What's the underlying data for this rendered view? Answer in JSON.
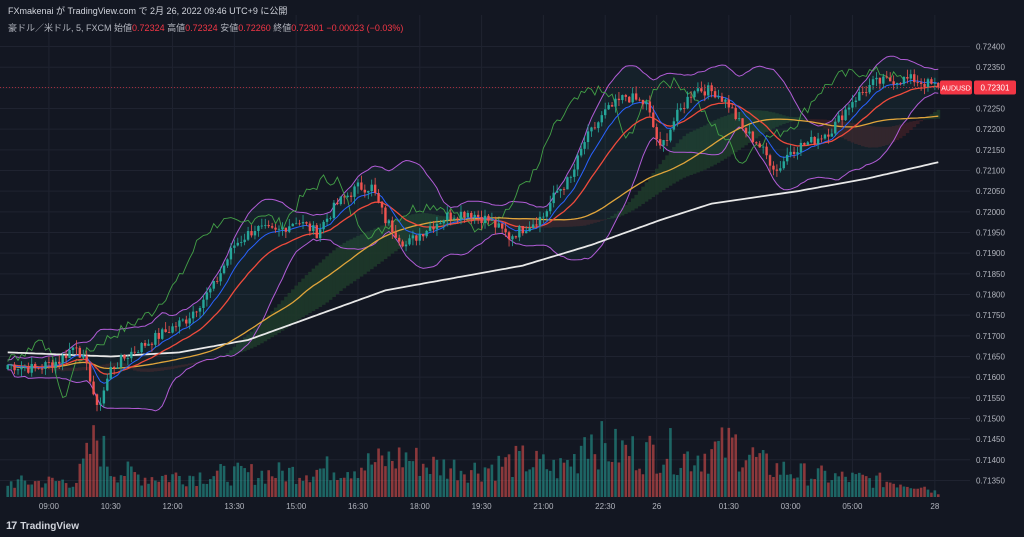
{
  "header": {
    "published_line": "FXmakenai が TradingView.com で 2月 26, 2022 09:46 UTC+9 に公開",
    "symbol_desc": "豪ドル／米ドル, 5, FXCM",
    "open_label": "始値",
    "open_value": "0.72324",
    "high_label": "高値",
    "high_value": "0.72324",
    "low_label": "安値",
    "low_value": "0.72260",
    "close_label": "終値",
    "close_value": "0.72301",
    "change": "−0.00023 (−0.03%)"
  },
  "brand": {
    "name": "TradingView",
    "logo_icon": "tradingview-logo-icon"
  },
  "colors": {
    "background": "#131722",
    "grid": "#1f2330",
    "text": "#b2b5be",
    "up": "#26a69a",
    "down": "#ef5350",
    "price_tag": "#f23645",
    "ma_white": "#e8e8e8",
    "ma_orange": "#e0a53b",
    "ma_red": "#ef4b3c",
    "ma_blue": "#2962ff",
    "bollinger": "#b15cd6",
    "chikou": "#43a047",
    "cloud_green": "#1f3b2a",
    "cloud_red": "#3b1f26"
  },
  "chart_data": {
    "type": "candlestick",
    "symbol": "AUDUSD",
    "timeframe": "5",
    "last_price": 0.72301,
    "price_tag_label": "AUDUSD",
    "price_tag_value": "0.72301",
    "ylim": [
      0.7131,
      0.7244
    ],
    "y_ticks": [
      "0.72400",
      "0.72350",
      "0.72300",
      "0.72250",
      "0.72200",
      "0.72150",
      "0.72100",
      "0.72050",
      "0.72000",
      "0.71950",
      "0.71900",
      "0.71850",
      "0.71800",
      "0.71750",
      "0.71700",
      "0.71650",
      "0.71600",
      "0.71550",
      "0.71500",
      "0.71450",
      "0.71400",
      "0.71350"
    ],
    "x_ticks": [
      "09:00",
      "10:30",
      "12:00",
      "13:30",
      "15:00",
      "16:30",
      "18:00",
      "19:30",
      "21:00",
      "22:30",
      "26",
      "01:30",
      "03:00",
      "05:00",
      "28"
    ],
    "x_tick_index": [
      12,
      30,
      48,
      66,
      84,
      102,
      120,
      138,
      156,
      174,
      189,
      210,
      228,
      246,
      270
    ],
    "bar_count": 272,
    "price_path": [
      [
        0,
        0.7163
      ],
      [
        8,
        0.7162
      ],
      [
        15,
        0.7164
      ],
      [
        20,
        0.7168
      ],
      [
        24,
        0.716
      ],
      [
        26,
        0.7152
      ],
      [
        30,
        0.7162
      ],
      [
        36,
        0.7166
      ],
      [
        44,
        0.717
      ],
      [
        52,
        0.7174
      ],
      [
        60,
        0.7182
      ],
      [
        66,
        0.7192
      ],
      [
        72,
        0.7196
      ],
      [
        78,
        0.7195
      ],
      [
        84,
        0.7198
      ],
      [
        90,
        0.7195
      ],
      [
        96,
        0.7202
      ],
      [
        102,
        0.7206
      ],
      [
        106,
        0.7206
      ],
      [
        110,
        0.7198
      ],
      [
        116,
        0.7192
      ],
      [
        122,
        0.7196
      ],
      [
        128,
        0.7199
      ],
      [
        134,
        0.72
      ],
      [
        140,
        0.7198
      ],
      [
        146,
        0.7194
      ],
      [
        150,
        0.7196
      ],
      [
        156,
        0.7199
      ],
      [
        160,
        0.7205
      ],
      [
        164,
        0.7208
      ],
      [
        168,
        0.7217
      ],
      [
        174,
        0.7224
      ],
      [
        180,
        0.7228
      ],
      [
        186,
        0.7226
      ],
      [
        190,
        0.7215
      ],
      [
        194,
        0.7222
      ],
      [
        200,
        0.723
      ],
      [
        206,
        0.7229
      ],
      [
        210,
        0.7226
      ],
      [
        214,
        0.722
      ],
      [
        218,
        0.7217
      ],
      [
        224,
        0.721
      ],
      [
        228,
        0.7215
      ],
      [
        234,
        0.7217
      ],
      [
        240,
        0.722
      ],
      [
        246,
        0.7227
      ],
      [
        252,
        0.7231
      ],
      [
        258,
        0.7232
      ],
      [
        264,
        0.7232
      ],
      [
        271,
        0.72301
      ]
    ],
    "ma_long_path": [
      [
        0,
        0.7166
      ],
      [
        30,
        0.7165
      ],
      [
        50,
        0.7166
      ],
      [
        70,
        0.7169
      ],
      [
        90,
        0.7175
      ],
      [
        110,
        0.7181
      ],
      [
        130,
        0.7184
      ],
      [
        150,
        0.7187
      ],
      [
        170,
        0.7192
      ],
      [
        190,
        0.7198
      ],
      [
        205,
        0.7202
      ],
      [
        230,
        0.7205
      ],
      [
        250,
        0.7208
      ],
      [
        271,
        0.7212
      ]
    ],
    "volume_path": [
      [
        0,
        0.18
      ],
      [
        20,
        0.2
      ],
      [
        26,
        0.75
      ],
      [
        30,
        0.35
      ],
      [
        40,
        0.25
      ],
      [
        60,
        0.28
      ],
      [
        80,
        0.3
      ],
      [
        100,
        0.38
      ],
      [
        110,
        0.45
      ],
      [
        116,
        0.5
      ],
      [
        122,
        0.4
      ],
      [
        136,
        0.35
      ],
      [
        150,
        0.45
      ],
      [
        160,
        0.35
      ],
      [
        166,
        0.5
      ],
      [
        168,
        0.85
      ],
      [
        174,
        0.6
      ],
      [
        186,
        0.55
      ],
      [
        192,
        0.6
      ],
      [
        196,
        0.5
      ],
      [
        204,
        0.55
      ],
      [
        212,
        0.65
      ],
      [
        220,
        0.4
      ],
      [
        230,
        0.3
      ],
      [
        240,
        0.25
      ],
      [
        250,
        0.22
      ],
      [
        260,
        0.18
      ],
      [
        266,
        0.15
      ],
      [
        271,
        0.05
      ]
    ]
  }
}
